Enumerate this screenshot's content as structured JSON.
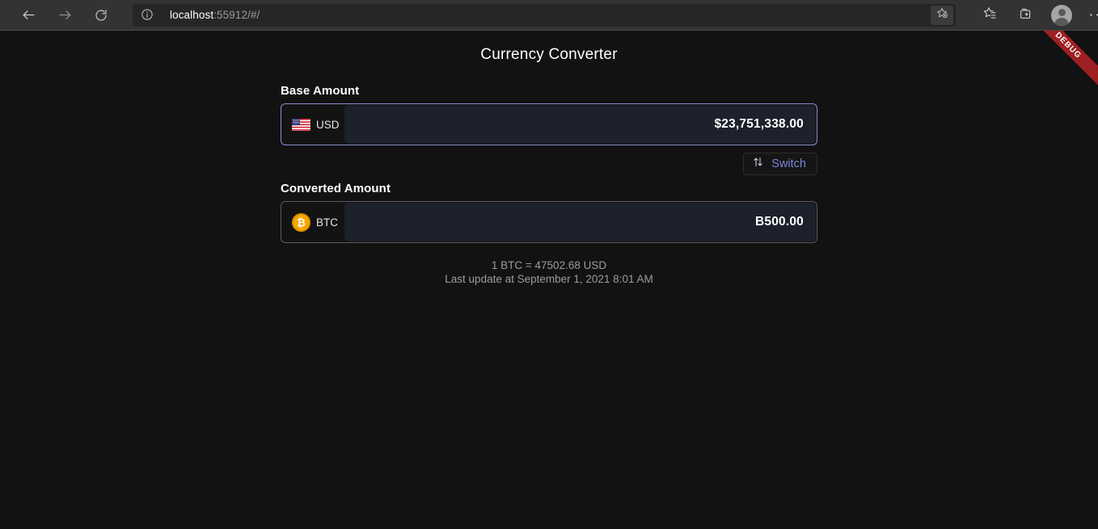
{
  "browser": {
    "back_icon": "arrow-left-icon",
    "forward_icon": "arrow-right-icon",
    "reload_icon": "reload-icon",
    "info_icon": "info-icon",
    "url_host": "localhost",
    "url_rest": ":55912/#/",
    "add_favorite_icon": "star-plus-icon",
    "favorites_icon": "favorites-star-list-icon",
    "collections_icon": "collections-icon",
    "profile_icon": "profile-avatar-icon",
    "settings_icon": "ellipsis-icon",
    "menu_dots": "···"
  },
  "page": {
    "debug_banner": "DEBUG",
    "title": "Currency Converter",
    "base": {
      "label": "Base Amount",
      "currency_code": "USD",
      "currency_flag": "us-flag-icon",
      "amount": "$23,751,338.00"
    },
    "switch": {
      "label": "Switch",
      "icon": "swap-vertical-icon"
    },
    "converted": {
      "label": "Converted Amount",
      "currency_code": "BTC",
      "currency_icon": "bitcoin-coin-icon",
      "currency_symbol": "₿",
      "amount": "B500.00"
    },
    "rate_line": "1 BTC = 47502.68 USD",
    "update_line": "Last update at September 1, 2021 8:01 AM"
  },
  "colors": {
    "page_bg": "#121212",
    "chrome_bg": "#333333",
    "input_bg": "#1d212b",
    "focus_border": "#8a8fd4",
    "accent_link": "#7c84d8",
    "btc_orange": "#f7a600",
    "debug_red": "#9e1f21"
  }
}
